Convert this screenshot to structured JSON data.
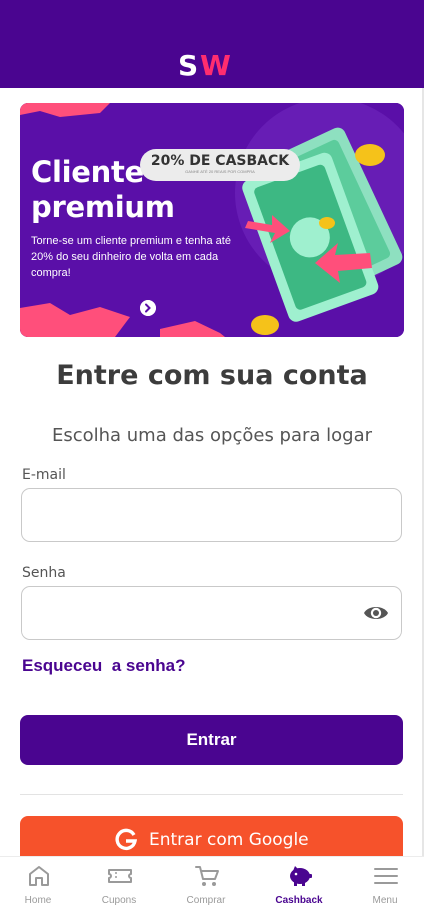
{
  "app": {
    "logo_text": "SW"
  },
  "banner": {
    "title_line1": "Cliente",
    "title_line2": "premium",
    "body": "Torne-se um cliente premium e tenha até 20% do seu dinheiro de volta em cada compra!",
    "pill_main": "20% DE CASBACK",
    "pill_small": "GANHE ATÉ 20 REAIS POR COMPRA"
  },
  "login": {
    "title": "Entre com sua conta",
    "subtitle": "Escolha uma das opções para logar",
    "email_label": "E-mail",
    "email_value": "",
    "password_label": "Senha",
    "password_value": "",
    "forgot_label": "Esqueceu  a senha?",
    "submit_label": "Entrar",
    "google_label": "Entrar com Google"
  },
  "tabs": [
    {
      "label": "Home",
      "icon": "home-icon",
      "active": false
    },
    {
      "label": "Cupons",
      "icon": "ticket-icon",
      "active": false
    },
    {
      "label": "Comprar",
      "icon": "cart-icon",
      "active": false
    },
    {
      "label": "Cashback",
      "icon": "piggy-bank-icon",
      "active": true
    },
    {
      "label": "Menu",
      "icon": "menu-icon",
      "active": false
    }
  ],
  "colors": {
    "brand_purple": "#4a0590",
    "google_orange": "#f6522b",
    "logo_pink": "#ff2d6f"
  }
}
